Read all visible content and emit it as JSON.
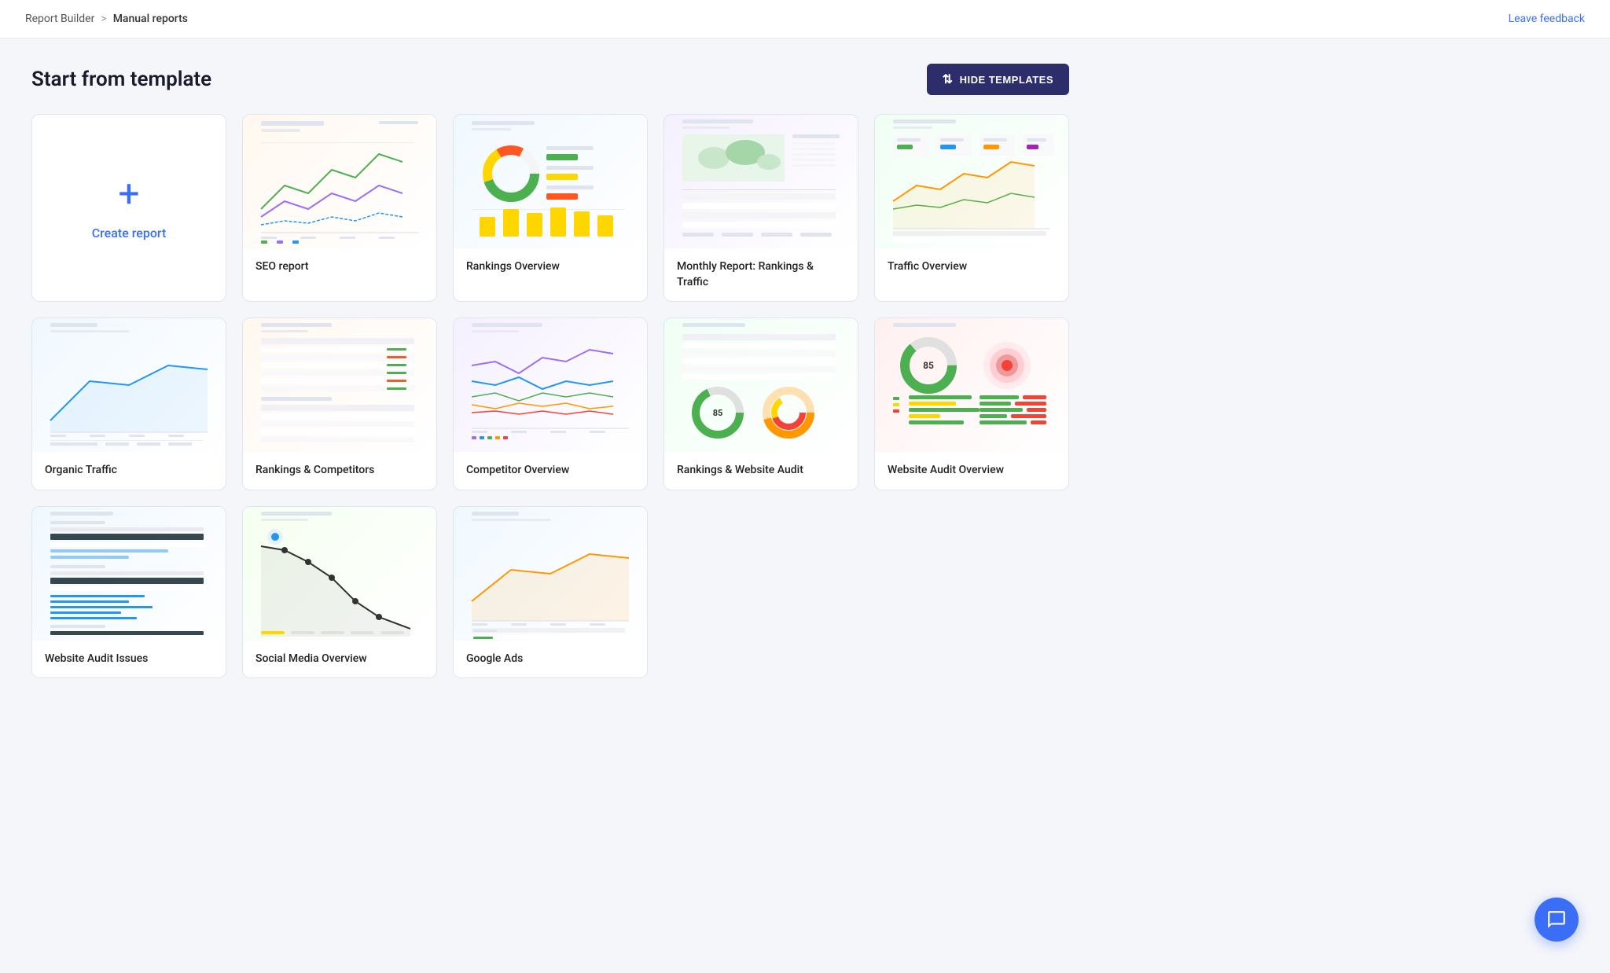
{
  "topnav": {
    "breadcrumb_root": "Report Builder",
    "breadcrumb_sep": ">",
    "breadcrumb_current": "Manual reports",
    "leave_feedback": "Leave feedback"
  },
  "section": {
    "title": "Start from template",
    "hide_btn": "HIDE TEMPLATES"
  },
  "templates": [
    {
      "id": "create",
      "label": "Create report",
      "type": "create"
    },
    {
      "id": "seo",
      "label": "SEO report",
      "type": "seo"
    },
    {
      "id": "rankings-overview",
      "label": "Rankings Overview",
      "type": "rankings-overview"
    },
    {
      "id": "monthly",
      "label": "Monthly Report: Rankings & Traffic",
      "type": "monthly"
    },
    {
      "id": "traffic-overview",
      "label": "Traffic Overview",
      "type": "traffic-ov"
    },
    {
      "id": "organic",
      "label": "Organic Traffic",
      "type": "organic"
    },
    {
      "id": "rankings-comp",
      "label": "Rankings & Competitors",
      "type": "rankings-comp"
    },
    {
      "id": "competitor-overview",
      "label": "Competitor Overview",
      "type": "competitor"
    },
    {
      "id": "rwa",
      "label": "Rankings & Website Audit",
      "type": "rwa"
    },
    {
      "id": "audit-overview",
      "label": "Website Audit Overview",
      "type": "audit-ov"
    },
    {
      "id": "audit-issues",
      "label": "Website Audit Issues",
      "type": "audit-issues"
    },
    {
      "id": "social",
      "label": "Social Media Overview",
      "type": "social"
    },
    {
      "id": "google-ads",
      "label": "Google Ads",
      "type": "google-ads"
    }
  ]
}
